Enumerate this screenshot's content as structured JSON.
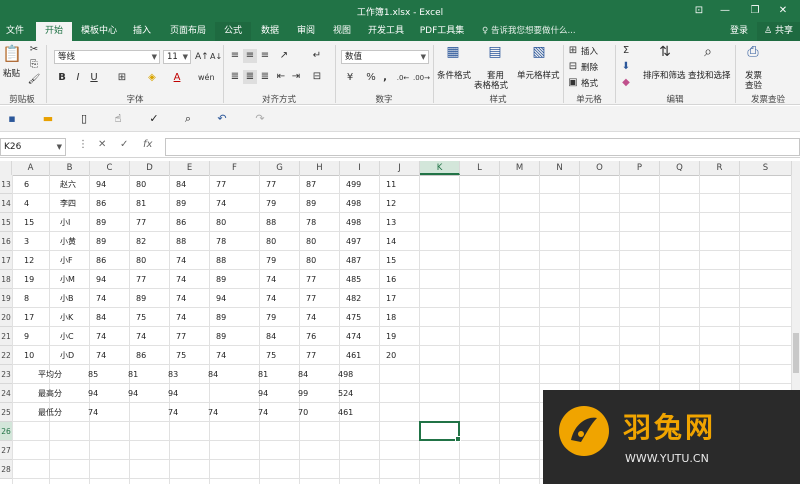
{
  "window": {
    "title": "工作簿1.xlsx - Excel"
  },
  "tabs": [
    "文件",
    "开始",
    "模板中心",
    "插入",
    "页面布局",
    "公式",
    "数据",
    "审阅",
    "视图",
    "开发工具",
    "PDF工具集"
  ],
  "tell_me": "告诉我您想要做什么...",
  "login": "登录",
  "share": "共享",
  "ribbon": {
    "paste": "粘贴",
    "font_name": "等线",
    "font_size": "11",
    "number_format": "数值",
    "conditional_format": "条件格式",
    "table_format_1": "套用",
    "table_format_2": "表格格式",
    "cell_style": "单元格样式",
    "insert": "插入",
    "delete": "删除",
    "format": "格式",
    "sort_filter": "排序和筛选",
    "find_select": "查找和选择",
    "invoice_1": "发票",
    "invoice_2": "查验",
    "groups": {
      "clipboard": "剪贴板",
      "font": "字体",
      "alignment": "对齐方式",
      "number": "数字",
      "styles": "样式",
      "cells": "单元格",
      "editing": "编辑",
      "invoice": "发票查验"
    }
  },
  "name_box": "K26",
  "columns": [
    "A",
    "B",
    "C",
    "D",
    "E",
    "F",
    "G",
    "H",
    "I",
    "J",
    "K",
    "L",
    "M",
    "N",
    "O",
    "P",
    "Q",
    "R",
    "S"
  ],
  "row_numbers": [
    "13",
    "14",
    "15",
    "16",
    "17",
    "18",
    "19",
    "20",
    "21",
    "22",
    "23",
    "24",
    "25",
    "26",
    "27",
    "28"
  ],
  "rows": [
    [
      "6",
      "赵六",
      "94",
      "80",
      "84",
      "77",
      "77",
      "87",
      "499",
      "11"
    ],
    [
      "4",
      "李四",
      "86",
      "81",
      "89",
      "74",
      "79",
      "89",
      "498",
      "12"
    ],
    [
      "15",
      "小I",
      "89",
      "77",
      "86",
      "80",
      "88",
      "78",
      "498",
      "13"
    ],
    [
      "3",
      "小黄",
      "89",
      "82",
      "88",
      "78",
      "80",
      "80",
      "497",
      "14"
    ],
    [
      "12",
      "小F",
      "86",
      "80",
      "74",
      "88",
      "79",
      "80",
      "487",
      "15"
    ],
    [
      "19",
      "小M",
      "94",
      "77",
      "74",
      "89",
      "74",
      "77",
      "485",
      "16"
    ],
    [
      "8",
      "小B",
      "74",
      "89",
      "74",
      "94",
      "74",
      "77",
      "482",
      "17"
    ],
    [
      "17",
      "小K",
      "84",
      "75",
      "74",
      "89",
      "79",
      "74",
      "475",
      "18"
    ],
    [
      "9",
      "小C",
      "74",
      "74",
      "77",
      "89",
      "84",
      "76",
      "474",
      "19"
    ],
    [
      "10",
      "小D",
      "74",
      "86",
      "75",
      "74",
      "75",
      "77",
      "461",
      "20"
    ]
  ],
  "summary": [
    {
      "label": "平均分",
      "values": [
        "85",
        "81",
        "83",
        "84",
        "81",
        "84",
        "498"
      ]
    },
    {
      "label": "最高分",
      "values": [
        "94",
        "94",
        "94",
        "",
        "94",
        "99",
        "524"
      ]
    },
    {
      "label": "最低分",
      "values": [
        "74",
        "",
        "74",
        "74",
        "74",
        "70",
        "461"
      ]
    }
  ],
  "watermark": {
    "brand": "羽兔网",
    "url": "WWW.YUTU.CN"
  },
  "colors": {
    "accent": "#217346",
    "watermark_bg": "#2a2a2a",
    "watermark_orange": "#f0a400"
  }
}
